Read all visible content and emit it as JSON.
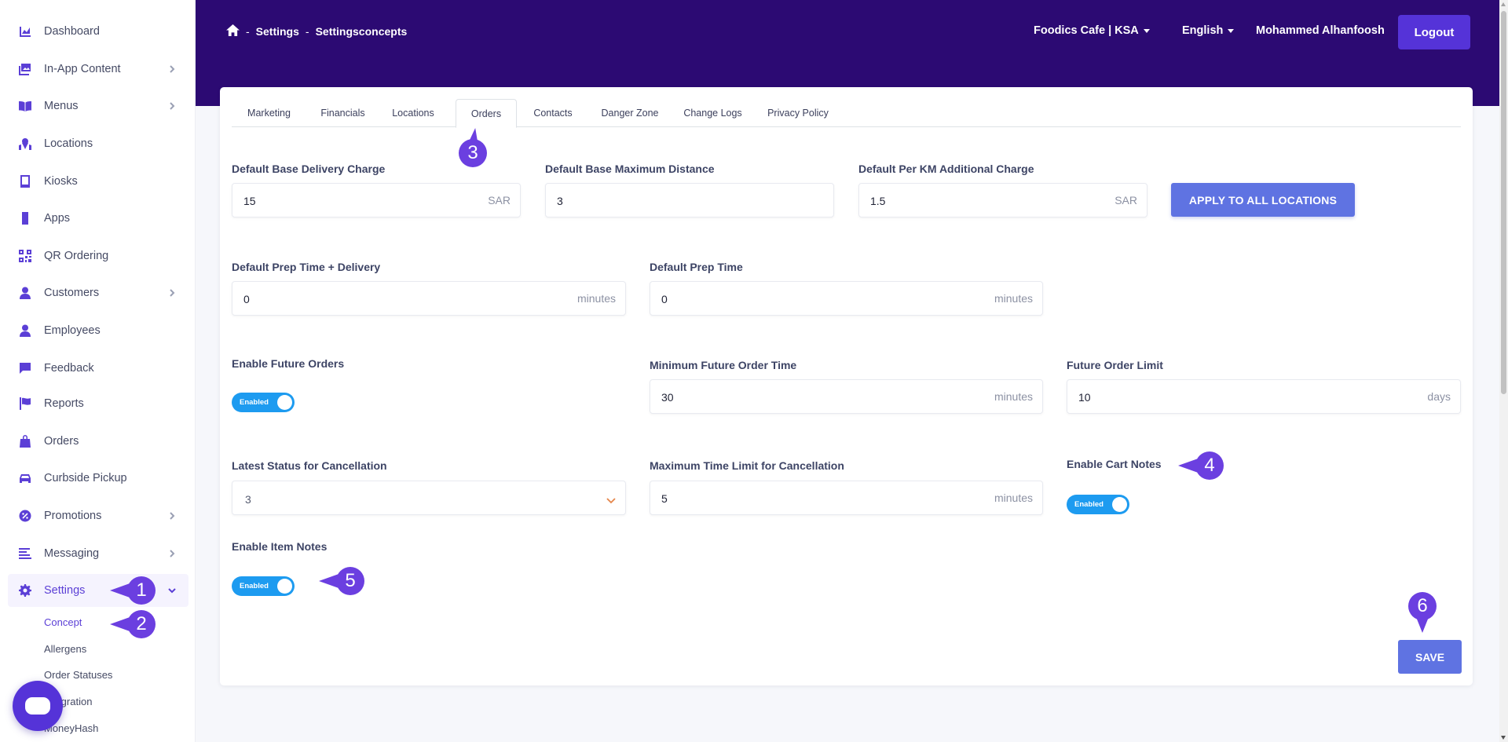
{
  "sidebar": {
    "items": [
      {
        "label": "Dashboard",
        "icon": "chart-area-icon"
      },
      {
        "label": "In-App Content",
        "icon": "images-icon"
      },
      {
        "label": "Menus",
        "icon": "book-open-icon"
      },
      {
        "label": "Locations",
        "icon": "map-marked-icon"
      },
      {
        "label": "Kiosks",
        "icon": "tablet-icon"
      },
      {
        "label": "Apps",
        "icon": "mobile-icon"
      },
      {
        "label": "QR Ordering",
        "icon": "qrcode-icon"
      },
      {
        "label": "Customers",
        "icon": "user-icon"
      },
      {
        "label": "Employees",
        "icon": "user-icon"
      },
      {
        "label": "Feedback",
        "icon": "comment-icon"
      },
      {
        "label": "Reports",
        "icon": "flag-icon"
      },
      {
        "label": "Orders",
        "icon": "shopping-bag-icon"
      },
      {
        "label": "Curbside Pickup",
        "icon": "car-icon"
      },
      {
        "label": "Promotions",
        "icon": "percent-badge-icon"
      },
      {
        "label": "Messaging",
        "icon": "align-left-icon"
      },
      {
        "label": "Settings",
        "icon": "gear-icon"
      }
    ],
    "sub_items": [
      {
        "label": "Concept"
      },
      {
        "label": "Allergens"
      },
      {
        "label": "Order Statuses"
      },
      {
        "label": "Integration"
      },
      {
        "label": "MoneyHash"
      }
    ]
  },
  "header": {
    "breadcrumb": [
      "Settings",
      "Settingsconcepts"
    ],
    "breadcrumb_sep": "-",
    "brand_dropdown": "Foodics Cafe | KSA",
    "language_dropdown": "English",
    "user_name": "Mohammed Alhanfoosh",
    "logout_label": "Logout"
  },
  "tabs": [
    {
      "label": "Marketing"
    },
    {
      "label": "Financials"
    },
    {
      "label": "Locations"
    },
    {
      "label": "Orders"
    },
    {
      "label": "Contacts"
    },
    {
      "label": "Danger Zone"
    },
    {
      "label": "Change Logs"
    },
    {
      "label": "Privacy Policy"
    }
  ],
  "form": {
    "base_delivery_charge": {
      "label": "Default Base Delivery Charge",
      "value": "15",
      "unit": "SAR"
    },
    "base_max_distance": {
      "label": "Default Base Maximum Distance",
      "value": "3"
    },
    "per_km_charge": {
      "label": "Default Per KM Additional Charge",
      "value": "1.5",
      "unit": "SAR"
    },
    "apply_all_label": "APPLY TO ALL LOCATIONS",
    "prep_time_delivery": {
      "label": "Default Prep Time + Delivery",
      "value": "0",
      "unit": "minutes"
    },
    "prep_time": {
      "label": "Default Prep Time",
      "value": "0",
      "unit": "minutes"
    },
    "future_orders": {
      "label": "Enable Future Orders",
      "toggle": "Enabled"
    },
    "min_future_order_time": {
      "label": "Minimum Future Order Time",
      "value": "30",
      "unit": "minutes"
    },
    "future_order_limit": {
      "label": "Future Order Limit",
      "value": "10",
      "unit": "days"
    },
    "cancel_status": {
      "label": "Latest Status for Cancellation",
      "value": "3"
    },
    "cancel_time_limit": {
      "label": "Maximum Time Limit for Cancellation",
      "value": "5",
      "unit": "minutes"
    },
    "cart_notes": {
      "label": "Enable Cart Notes",
      "toggle": "Enabled"
    },
    "item_notes": {
      "label": "Enable Item Notes",
      "toggle": "Enabled"
    },
    "save_label": "SAVE"
  },
  "markers": [
    "1",
    "2",
    "3",
    "4",
    "5",
    "6"
  ],
  "colors": {
    "header_bg": "#2c0a73",
    "accent": "#5533d8",
    "button": "#5f73e2",
    "toggle": "#1d9bf0",
    "marker": "#6b3fe0"
  }
}
